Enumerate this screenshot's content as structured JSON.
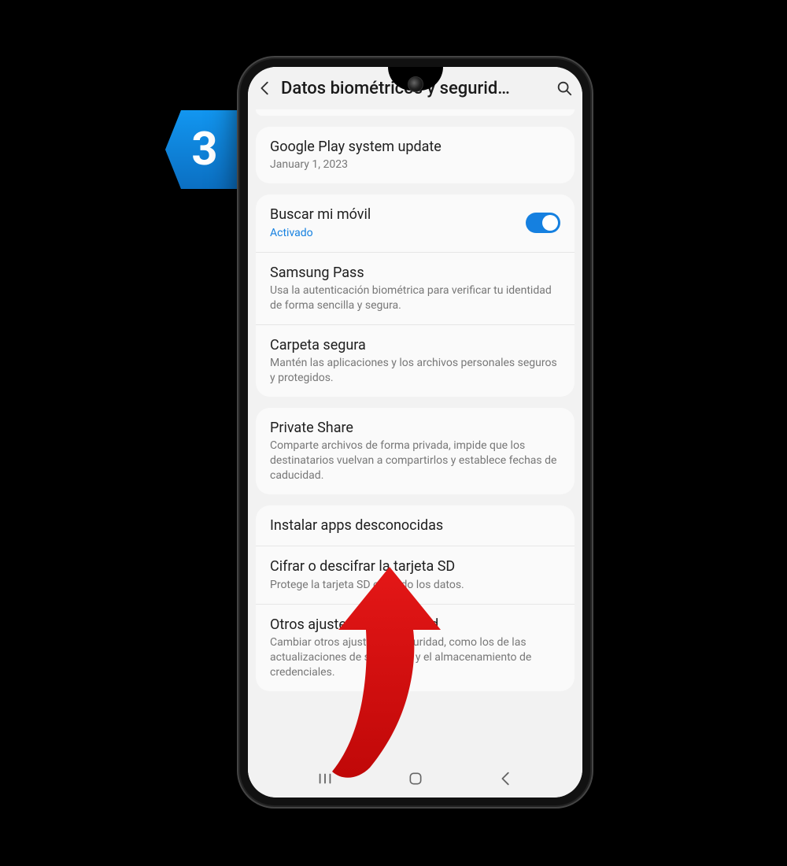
{
  "annotation": {
    "step_number": "3"
  },
  "appbar": {
    "title": "Datos biométricos y segurid…"
  },
  "groups": [
    {
      "rows": [
        {
          "label": "Google Play system update",
          "sub": "January 1, 2023"
        }
      ]
    },
    {
      "rows": [
        {
          "label": "Buscar mi móvil",
          "sub": "Activado",
          "sub_link": true,
          "toggle_on": true
        },
        {
          "label": "Samsung Pass",
          "sub": "Usa la autenticación biométrica para verificar tu identidad de forma sencilla y segura."
        },
        {
          "label": "Carpeta segura",
          "sub": "Mantén las aplicaciones y los archivos personales seguros y protegidos."
        }
      ]
    },
    {
      "rows": [
        {
          "label": "Private Share",
          "sub": "Comparte archivos de forma privada, impide que los destinatarios vuelvan a compartirlos y establece fechas de caducidad."
        }
      ]
    },
    {
      "rows": [
        {
          "label": "Instalar apps desconocidas"
        },
        {
          "label": "Cifrar o descifrar la tarjeta SD",
          "sub": "Protege la tarjeta SD cifrando los datos."
        },
        {
          "label": "Otros ajustes de seguridad",
          "sub": "Cambiar otros ajustes de seguridad, como los de las actualizaciones de seguridad y el almacenamiento de credenciales."
        }
      ]
    }
  ]
}
